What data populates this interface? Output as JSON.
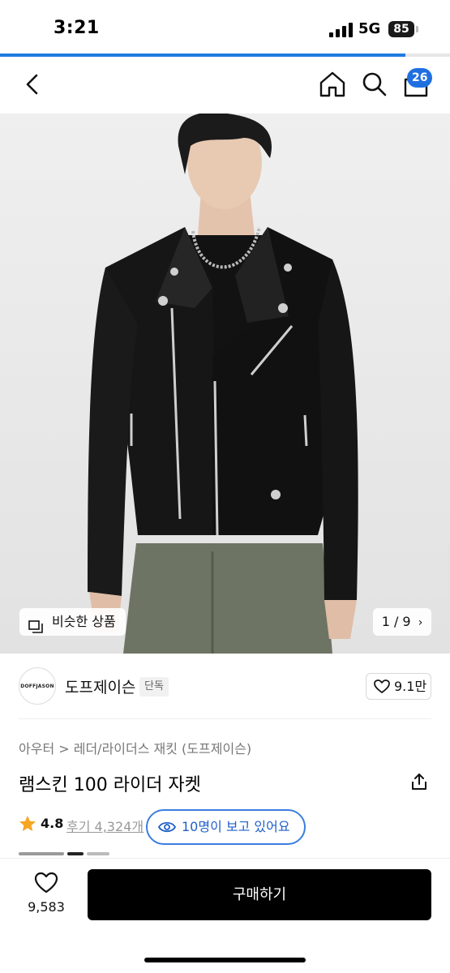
{
  "status_bar": {
    "time": "3:21",
    "network": "5G",
    "battery": "85"
  },
  "page_load_progress": 0.9,
  "nav": {
    "cart_badge": "26"
  },
  "hero": {
    "similar_label": "비슷한 상품",
    "page_indicator": "1 / 9"
  },
  "brand": {
    "logo_text": "DOFFJASON",
    "name": "도프제이슨",
    "tag": "단독",
    "likes": "9.1만"
  },
  "product": {
    "breadcrumb": "아우터 > 레더/라이더스 재킷 (도프제이슨)",
    "title": "램스킨 100 라이더 자켓",
    "rating": "4.8",
    "reviews": "후기 4,324개",
    "viewers": "10명이 보고 있어요"
  },
  "bottom_bar": {
    "wish_count": "9,583",
    "buy_label": "구매하기"
  },
  "colors": {
    "accent": "#1f6fe0",
    "buy_button": "#000000",
    "rating_star": "#f5a623"
  },
  "icons": [
    "back-arrow-icon",
    "home-icon",
    "search-icon",
    "cart-icon",
    "similar-items-icon",
    "chevron-right-icon",
    "heart-icon",
    "share-icon",
    "star-icon",
    "eye-icon"
  ]
}
